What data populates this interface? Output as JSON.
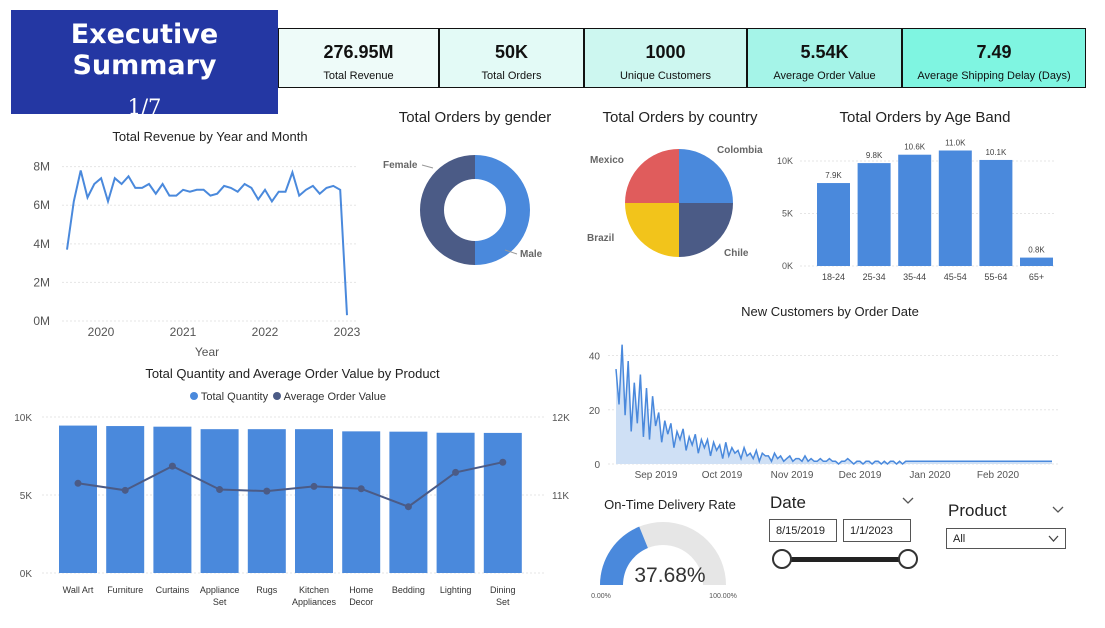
{
  "header": {
    "title": "Executive Summary",
    "page": "1/7"
  },
  "kpis": [
    {
      "value": "276.95M",
      "label": "Total Revenue",
      "color": "#eefbf9"
    },
    {
      "value": "50K",
      "label": "Total Orders",
      "color": "#e3faf6"
    },
    {
      "value": "1000",
      "label": "Unique Customers",
      "color": "#cdf7f0"
    },
    {
      "value": "5.54K",
      "label": "Average Order Value",
      "color": "#a5f4e8"
    },
    {
      "value": "7.49",
      "label": "Average Shipping Delay (Days)",
      "color": "#7ff5e1"
    }
  ],
  "colors": {
    "primary": "#4a89dc",
    "dark": "#4b5b86",
    "red": "#e05c5c",
    "yellow": "#f2c41b",
    "gauge_bg": "#e6e6e6",
    "title_bg": "#2437a3"
  },
  "revenue_chart": {
    "title": "Total Revenue by Year and Month",
    "xlabel": "Year",
    "chart_data": {
      "type": "line",
      "y_ticks": [
        "8M",
        "6M",
        "4M",
        "2M",
        "0M"
      ],
      "x_ticks": [
        "2020",
        "2021",
        "2022",
        "2023"
      ],
      "ylim": [
        0,
        8500000
      ],
      "values": [
        3700000,
        6200000,
        7800000,
        6400000,
        7100000,
        7400000,
        6200000,
        7400000,
        7100000,
        7500000,
        6900000,
        6900000,
        7100000,
        6600000,
        7100000,
        6500000,
        6500000,
        6800000,
        6700000,
        6800000,
        6800000,
        6500000,
        6600000,
        7000000,
        6900000,
        6700000,
        7100000,
        6900000,
        6300000,
        6800000,
        6200000,
        6700000,
        6700000,
        7700000,
        6500000,
        6800000,
        7000000,
        6600000,
        6900000,
        7000000,
        6800000,
        300000
      ]
    }
  },
  "gender_chart": {
    "title": "Total Orders by gender",
    "chart_data": {
      "type": "pie",
      "donut": true,
      "labels": [
        "Male",
        "Female"
      ],
      "values": [
        50,
        50
      ]
    }
  },
  "country_chart": {
    "title": "Total Orders by country",
    "chart_data": {
      "type": "pie",
      "labels": [
        "Colombia",
        "Chile",
        "Brazil",
        "Mexico"
      ],
      "values": [
        25,
        25,
        25,
        25
      ]
    }
  },
  "age_chart": {
    "title": "Total Orders by Age Band",
    "chart_data": {
      "type": "bar",
      "categories": [
        "18-24",
        "25-34",
        "35-44",
        "45-54",
        "55-64",
        "65+"
      ],
      "values": [
        7900,
        9800,
        10600,
        11000,
        10100,
        800
      ],
      "labels": [
        "7.9K",
        "9.8K",
        "10.6K",
        "11.0K",
        "10.1K",
        "0.8K"
      ],
      "y_ticks": [
        "10K",
        "5K",
        "0K"
      ],
      "ylim": [
        0,
        12000
      ]
    }
  },
  "newcust_chart": {
    "title": "New Customers by Order Date",
    "chart_data": {
      "type": "area",
      "x_ticks": [
        "Sep 2019",
        "Oct 2019",
        "Nov 2019",
        "Dec 2019",
        "Jan 2020",
        "Feb 2020"
      ],
      "y_ticks": [
        "40",
        "20",
        "0"
      ],
      "ylim": [
        0,
        45
      ],
      "values": [
        35,
        22,
        44,
        18,
        38,
        12,
        30,
        15,
        33,
        10,
        28,
        9,
        25,
        14,
        19,
        8,
        16,
        11,
        15,
        6,
        12,
        9,
        13,
        5,
        10,
        7,
        11,
        4,
        9,
        6,
        9,
        3,
        8,
        5,
        7,
        2,
        8,
        3,
        6,
        4,
        5,
        2,
        6,
        3,
        4,
        2,
        5,
        1,
        4,
        3,
        3,
        1,
        4,
        2,
        3,
        1,
        2,
        3,
        1,
        2,
        2,
        1,
        3,
        1,
        2,
        1,
        1,
        2,
        1,
        1,
        2,
        1,
        1,
        0,
        1,
        1,
        2,
        1,
        0,
        1,
        1,
        0,
        1,
        1,
        0,
        1,
        1,
        0,
        1,
        0,
        1,
        1,
        0,
        1,
        0,
        1,
        1,
        1,
        1,
        1,
        1,
        1,
        1,
        1,
        1,
        1,
        1,
        1,
        1,
        1,
        1,
        1,
        1,
        1,
        1,
        1,
        1,
        1,
        1,
        1,
        1,
        1,
        1,
        1,
        1,
        1,
        1,
        1,
        1,
        1,
        1,
        1,
        1,
        1,
        1,
        1,
        1,
        1,
        1,
        1,
        1,
        1,
        1,
        1
      ]
    }
  },
  "product_chart": {
    "title": "Total Quantity and Average Order Value by Product",
    "legend": [
      "Total Quantity",
      "Average Order Value"
    ],
    "chart_data": {
      "type": "bar",
      "categories": [
        "Wall Art",
        "Furniture",
        "Curtains",
        "Appliance Set",
        "Rugs",
        "Kitchen Appliances",
        "Home Decor",
        "Bedding",
        "Lighting",
        "Dining Set"
      ],
      "series": [
        {
          "name": "Total Quantity",
          "values": [
            9450,
            9420,
            9380,
            9220,
            9220,
            9220,
            9080,
            9060,
            8990,
            8980
          ]
        },
        {
          "name": "Average Order Value",
          "values": [
            11150,
            11060,
            11370,
            11070,
            11050,
            11110,
            11080,
            10850,
            11290,
            11420
          ]
        }
      ],
      "y_ticks_left": [
        "10K",
        "5K",
        "0K"
      ],
      "y_ticks_right": [
        "12K",
        "11K"
      ],
      "ylim_left": [
        0,
        10000
      ],
      "ylim_right": [
        10000,
        12000
      ]
    }
  },
  "delivery": {
    "title": "On-Time Delivery Rate",
    "value": "37.68%",
    "rate": 0.3768,
    "min_label": "0.00%",
    "max_label": "100.00%"
  },
  "date_slicer": {
    "label": "Date",
    "start": "8/15/2019",
    "end": "1/1/2023"
  },
  "product_slicer": {
    "label": "Product",
    "value": "All"
  }
}
